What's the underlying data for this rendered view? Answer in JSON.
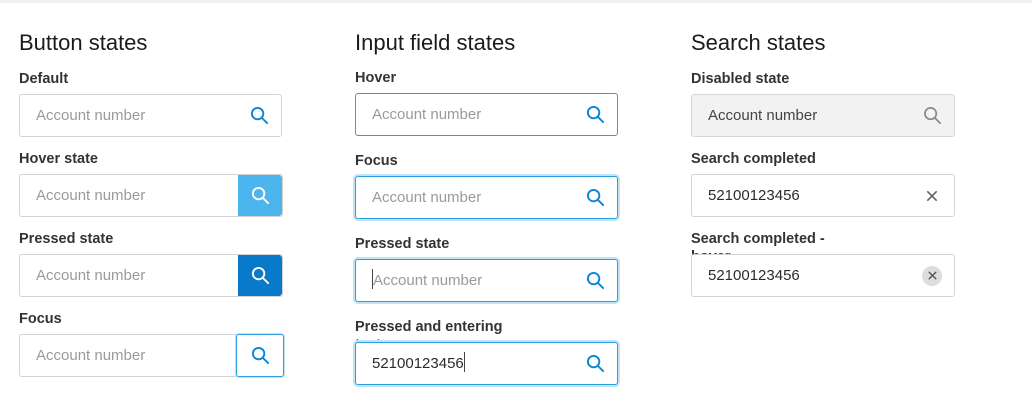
{
  "button_states": {
    "title": "Button states",
    "items": [
      {
        "label": "Default",
        "placeholder": "Account number"
      },
      {
        "label": "Hover state",
        "placeholder": "Account number"
      },
      {
        "label": "Pressed state",
        "placeholder": "Account number"
      },
      {
        "label": "Focus",
        "placeholder": "Account number"
      }
    ]
  },
  "input_states": {
    "title": "Input field states",
    "items": [
      {
        "label": "Hover",
        "placeholder": "Account number"
      },
      {
        "label": "Focus",
        "placeholder": "Account number"
      },
      {
        "label": "Pressed state",
        "placeholder": "Account number"
      },
      {
        "label": "Pressed and entering text",
        "value": "52100123456"
      }
    ]
  },
  "search_states": {
    "title": "Search states",
    "items": [
      {
        "label": "Disabled state",
        "placeholder": "Account number"
      },
      {
        "label": "Search completed",
        "value": "52100123456"
      },
      {
        "label": "Search completed - hover",
        "value": "52100123456"
      }
    ]
  },
  "colors": {
    "accent": "#2c9fe0",
    "hover_button": "#4cb5ee",
    "pressed_button": "#0979c9",
    "focus_glow": "#bfe3f8",
    "border": "#d2d2d2",
    "disabled_bg": "#f2f2f2"
  },
  "icons": {
    "search": "search-icon",
    "clear": "close-icon"
  }
}
